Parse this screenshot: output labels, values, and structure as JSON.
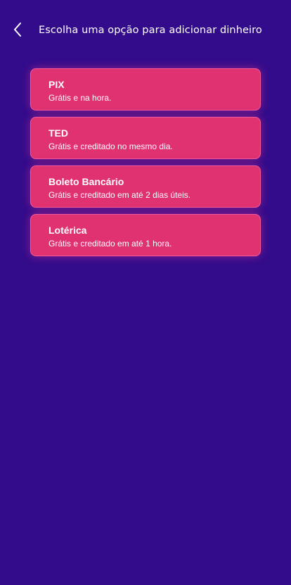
{
  "header": {
    "back_icon": "chevron-left-icon",
    "title": "Escolha uma opção para adicionar dinheiro"
  },
  "options": [
    {
      "title": "PIX",
      "description": "Grátis e na hora."
    },
    {
      "title": "TED",
      "description": "Grátis e creditado no mesmo dia."
    },
    {
      "title": "Boleto Bancário",
      "description": "Grátis e creditado em até 2 dias úteis."
    },
    {
      "title": "Lotérica",
      "description": "Grátis e creditado em até 1 hora."
    }
  ],
  "colors": {
    "background": "#330c8c",
    "card": "#e03170",
    "text": "#ffffff"
  }
}
